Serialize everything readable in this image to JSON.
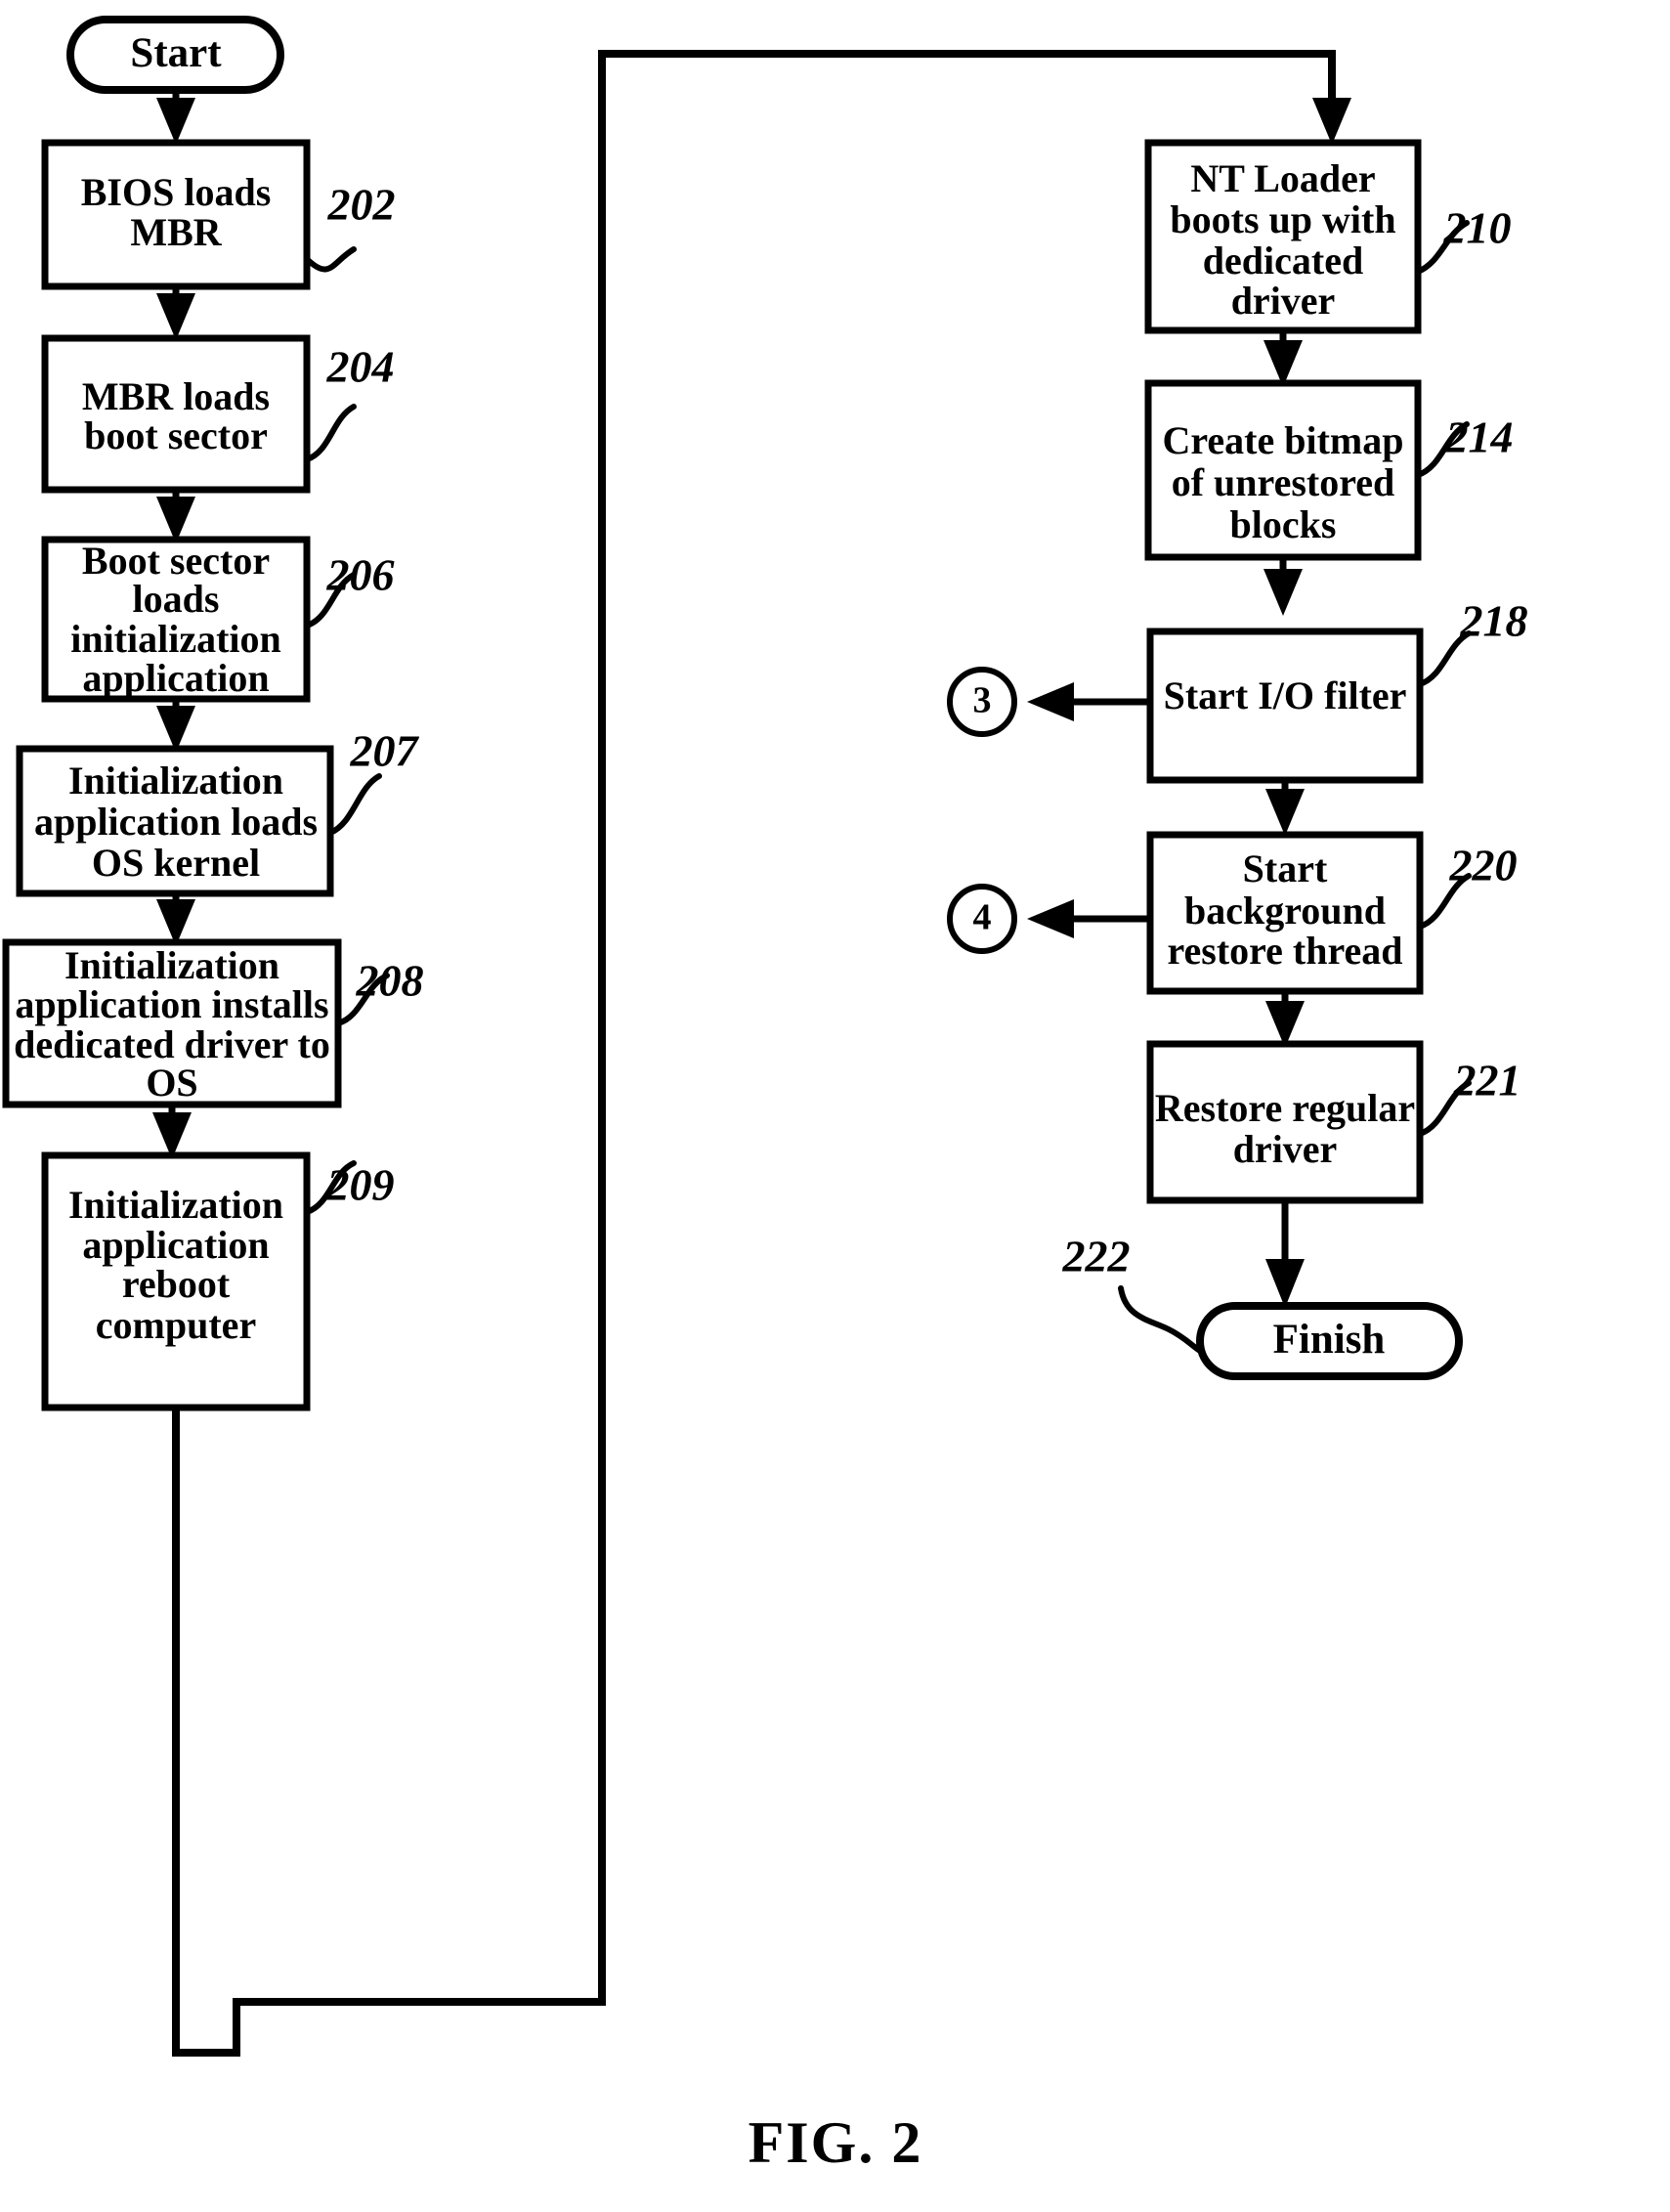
{
  "figure": {
    "caption": "FIG. 2",
    "title": "Boot and restore process flowchart"
  },
  "terminals": [
    {
      "id": "start",
      "label": "Start"
    },
    {
      "id": "finish",
      "label": "Finish",
      "ref": "222"
    }
  ],
  "process_boxes": [
    {
      "id": "bios_loads_mbr",
      "ref": "202",
      "lines": [
        "BIOS loads",
        "MBR"
      ]
    },
    {
      "id": "mbr_loads_boot_sector",
      "ref": "204",
      "lines": [
        "MBR loads",
        "boot sector"
      ]
    },
    {
      "id": "boot_sector_loads_init_app",
      "ref": "206",
      "lines": [
        "Boot sector",
        "loads",
        "initialization",
        "application"
      ]
    },
    {
      "id": "init_app_loads_os_kernel",
      "ref": "207",
      "lines": [
        "Initialization",
        "application loads",
        "OS kernel"
      ]
    },
    {
      "id": "init_app_installs_driver",
      "ref": "208",
      "lines": [
        "Initialization",
        "application  installs",
        "dedicated driver to",
        "OS"
      ]
    },
    {
      "id": "init_app_reboot_computer",
      "ref": "209",
      "lines": [
        "Initialization",
        "application",
        "reboot",
        "computer"
      ]
    },
    {
      "id": "nt_loader_boots_up",
      "ref": "210",
      "lines": [
        "NT Loader",
        "boots up with",
        "dedicated",
        "driver"
      ]
    },
    {
      "id": "create_bitmap_unrestored",
      "ref": "214",
      "lines": [
        "Create bitmap",
        "of unrestored",
        "blocks"
      ]
    },
    {
      "id": "start_io_filter",
      "ref": "218",
      "lines": [
        "Start I/O filter"
      ]
    },
    {
      "id": "start_background_restore_thread",
      "ref": "220",
      "lines": [
        "Start",
        "background",
        "restore thread"
      ]
    },
    {
      "id": "restore_regular_driver",
      "ref": "221",
      "lines": [
        "Restore regular",
        "driver"
      ]
    }
  ],
  "connectors": [
    {
      "id": "connector-3",
      "label": "3",
      "from": "start_io_filter"
    },
    {
      "id": "connector-4",
      "label": "4",
      "from": "start_background_restore_thread"
    }
  ]
}
